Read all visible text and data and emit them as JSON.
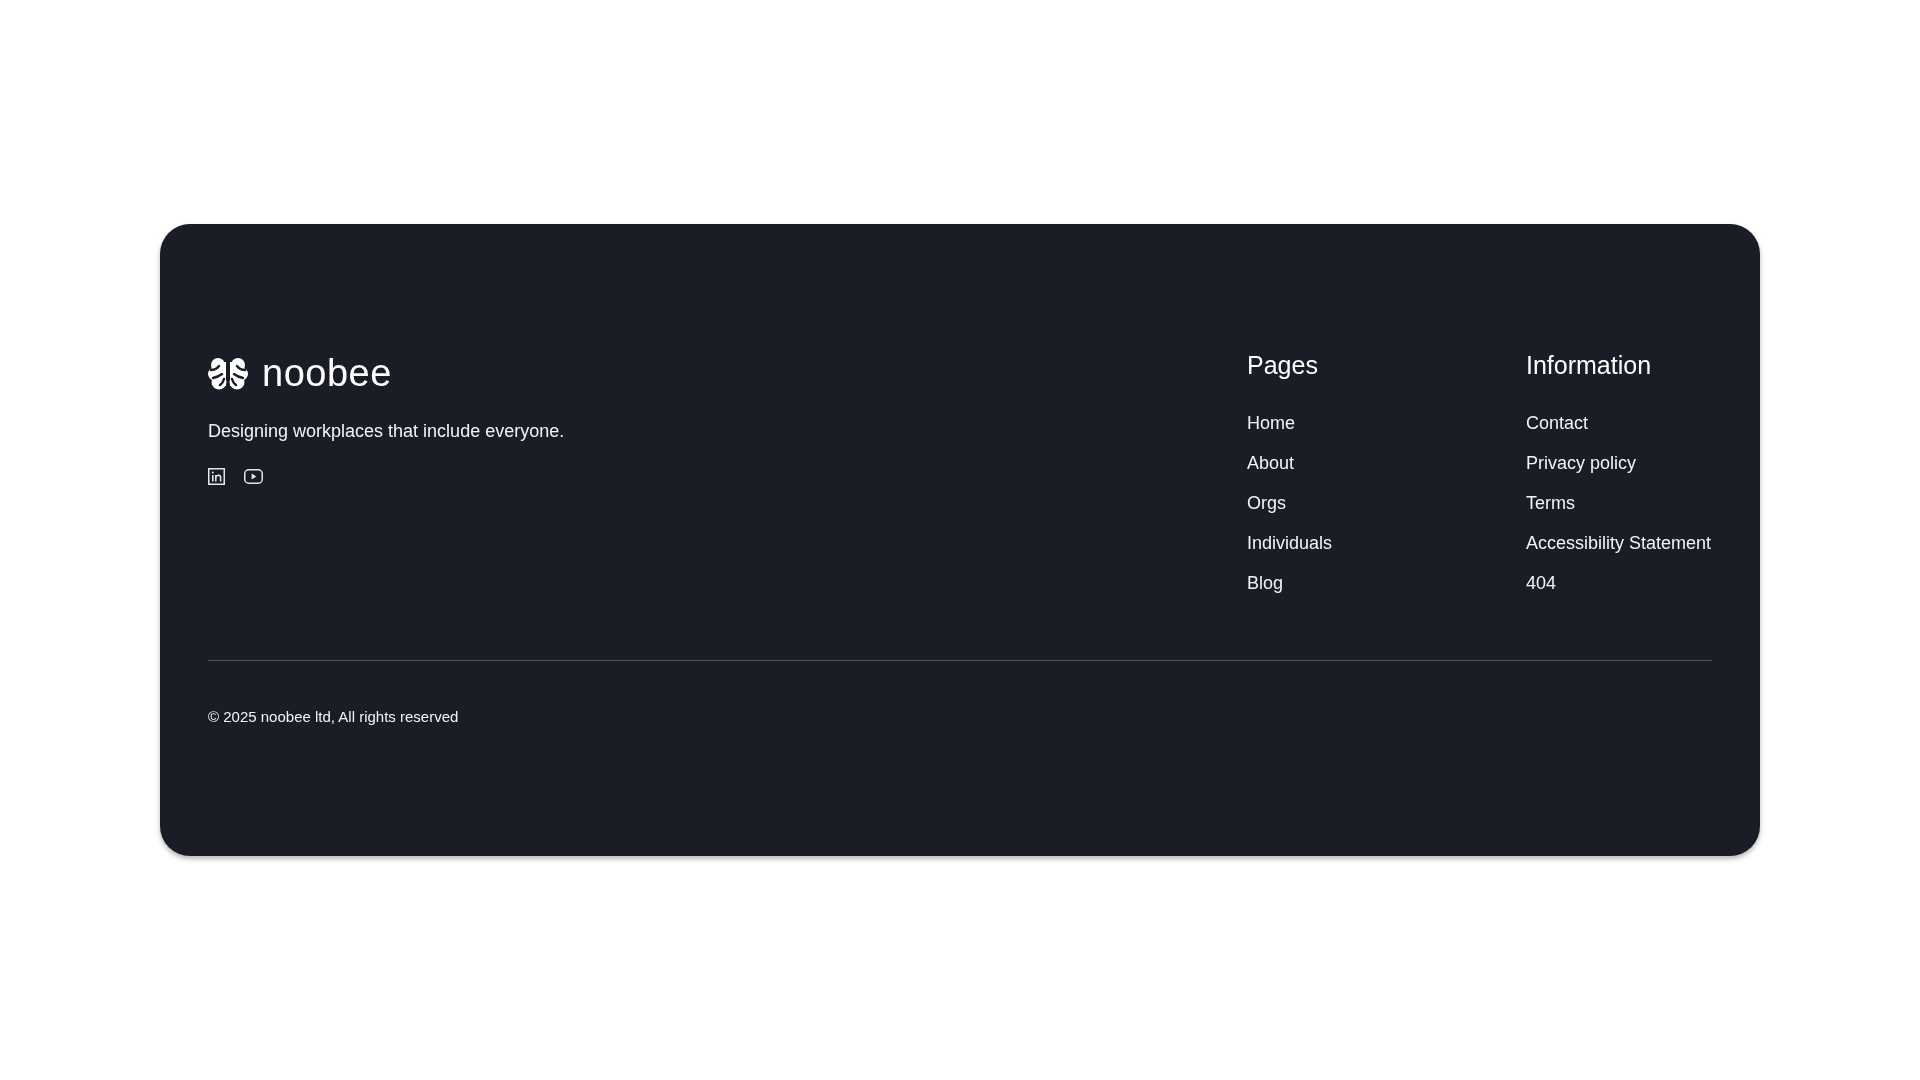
{
  "brand": {
    "name": "noobee",
    "tagline": "Designing workplaces that include everyone.",
    "social_links": [
      {
        "kind": "linkedin"
      },
      {
        "kind": "youtube"
      }
    ]
  },
  "nav_columns": [
    {
      "heading": "Pages",
      "links": [
        "Home",
        "About",
        "Orgs",
        "Individuals",
        "Blog"
      ]
    },
    {
      "heading": "Information",
      "links": [
        "Contact",
        "Privacy policy",
        "Terms",
        "Accessibility Statement",
        "404"
      ]
    }
  ],
  "copyright": "© 2025 noobee ltd, All rights reserved"
}
